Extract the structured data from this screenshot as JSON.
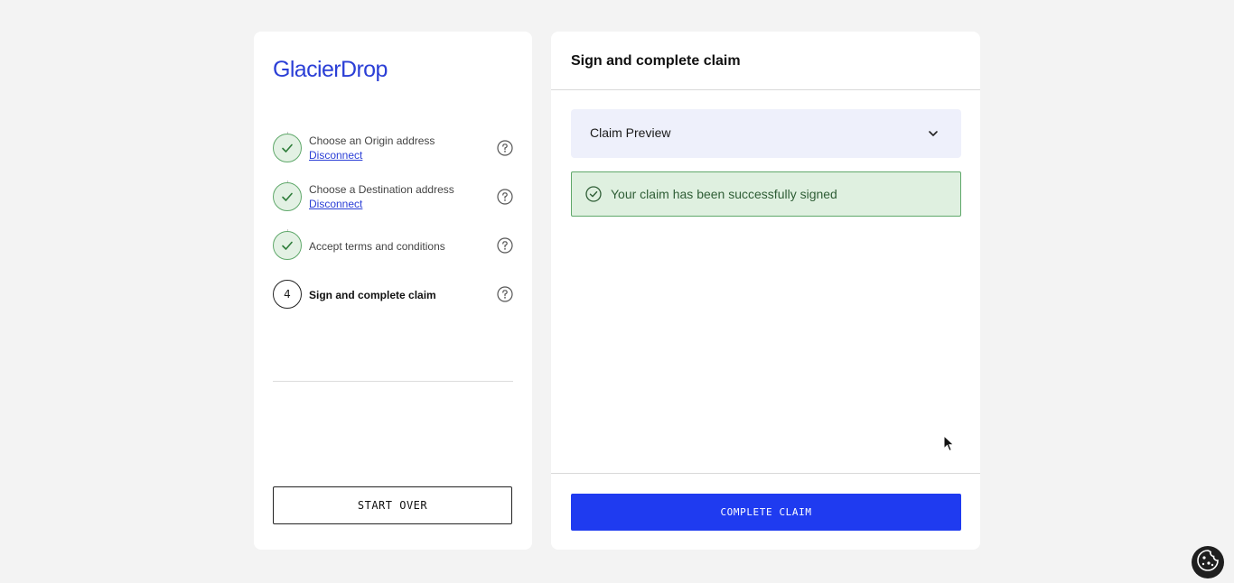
{
  "brand": {
    "logo_text": "GlacierDrop"
  },
  "sidebar": {
    "steps": [
      {
        "label": "Choose an Origin address",
        "link": "Disconnect",
        "status": "done"
      },
      {
        "label": "Choose a Destination address",
        "link": "Disconnect",
        "status": "done"
      },
      {
        "label": "Accept terms and conditions",
        "status": "done"
      },
      {
        "label": "Sign and complete claim",
        "number": "4",
        "status": "current"
      }
    ],
    "start_over_label": "START OVER"
  },
  "main": {
    "title": "Sign and complete claim",
    "preview_label": "Claim Preview",
    "success_message": "Your claim has been successfully signed",
    "complete_label": "COMPLETE CLAIM"
  },
  "colors": {
    "accent": "#1f3bf0",
    "brand": "#2b3fd6",
    "success_bg": "#dff0e0",
    "success_border": "#5fa86a",
    "preview_bg": "#eef0fb"
  },
  "icons": {
    "step_done": "check-icon",
    "help": "help-circle-icon",
    "preview_toggle": "chevron-down-icon",
    "success": "check-circle-icon",
    "cookie": "cookie-icon"
  }
}
